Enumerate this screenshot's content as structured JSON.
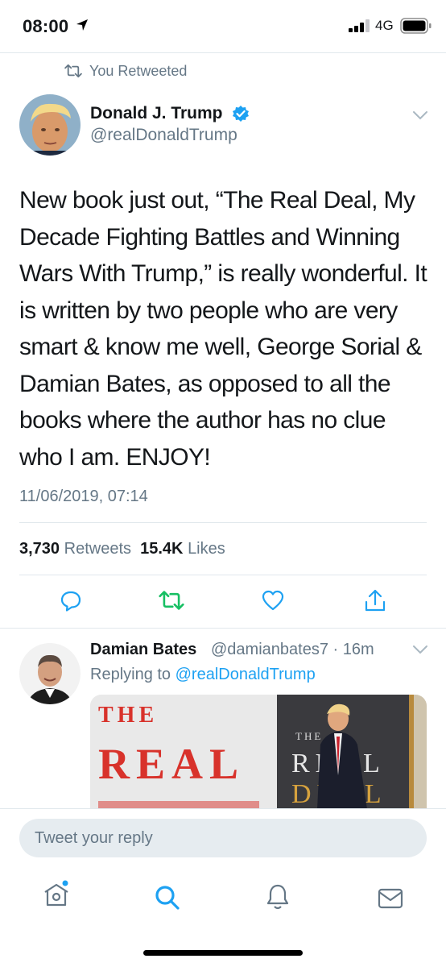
{
  "status_bar": {
    "time": "08:00",
    "network": "4G",
    "location_icon": "location-arrow-icon",
    "signal_icon": "signal-bars-icon",
    "battery_icon": "battery-icon"
  },
  "retweet_context": {
    "icon": "retweet-icon",
    "label": "You Retweeted"
  },
  "tweet": {
    "author_name": "Donald J. Trump",
    "author_handle": "@realDonaldTrump",
    "verified_icon": "verified-badge-icon",
    "text": "New book just out, “The Real Deal, My Decade Fighting Battles and Winning Wars With Trump,” is really wonderful. It is written by two people who are very smart & know me well, George Sorial & Damian Bates, as opposed to all the books where the author has no clue who I am. ENJOY!",
    "timestamp": "11/06/2019, 07:14",
    "retweet_count": "3,730",
    "retweet_label": "Retweets",
    "like_count": "15.4K",
    "like_label": "Likes"
  },
  "actions": {
    "reply_icon": "reply-icon",
    "retweet_icon": "retweet-icon",
    "like_icon": "heart-icon",
    "share_icon": "share-icon",
    "retweet_color": "#17bf63",
    "icon_color": "#1da1f2"
  },
  "reply": {
    "author_name": "Damian Bates",
    "author_handle": "@damianbates7 · 16m",
    "replying_prefix": "Replying to",
    "replying_to": "@realDonaldTrump",
    "media": {
      "book_title_left": [
        "THE",
        "REAL"
      ],
      "book_cover_right": [
        "THE",
        "REAL",
        "DEAL"
      ]
    }
  },
  "composer": {
    "placeholder": "Tweet your reply"
  },
  "tab_bar": {
    "home_icon": "home-icon",
    "search_icon": "search-icon",
    "notifications_icon": "bell-icon",
    "messages_icon": "mail-icon",
    "accent": "#1da1f2",
    "inactive": "#657786"
  }
}
